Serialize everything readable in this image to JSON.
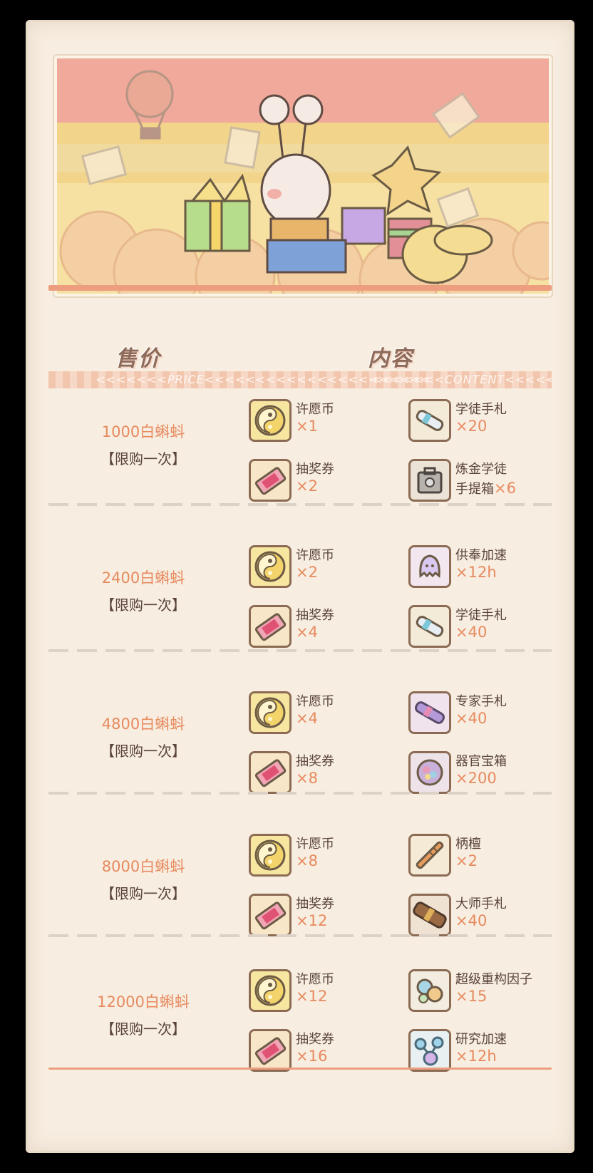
{
  "header": {
    "price_label": "售价",
    "content_label": "内容",
    "price_en": "PRICE",
    "content_en": "CONTENT"
  },
  "colors": {
    "accent": "#e78a5f",
    "text": "#5a443c",
    "rule": "#ec9e7f",
    "paper": "#f7ede0"
  },
  "tiers": [
    {
      "price": "1000白蝌蚪",
      "limit": "【限购一次】",
      "items": [
        {
          "name": "许愿币",
          "qty": "×1",
          "icon": "wish-coin-icon"
        },
        {
          "name": "学徒手札",
          "qty": "×20",
          "icon": "apprentice-scroll-icon"
        },
        {
          "name": "抽奖券",
          "qty": "×2",
          "icon": "lottery-ticket-icon"
        },
        {
          "name": "炼金学徒",
          "name2": "手提箱",
          "qty": "×6",
          "icon": "alchemy-suitcase-icon"
        }
      ]
    },
    {
      "price": "2400白蝌蚪",
      "limit": "【限购一次】",
      "items": [
        {
          "name": "许愿币",
          "qty": "×2",
          "icon": "wish-coin-icon"
        },
        {
          "name": "供奉加速",
          "qty": "×12h",
          "icon": "offering-boost-icon"
        },
        {
          "name": "抽奖券",
          "qty": "×4",
          "icon": "lottery-ticket-icon"
        },
        {
          "name": "学徒手札",
          "qty": "×40",
          "icon": "apprentice-scroll-icon"
        }
      ]
    },
    {
      "price": "4800白蝌蚪",
      "limit": "【限购一次】",
      "items": [
        {
          "name": "许愿币",
          "qty": "×4",
          "icon": "wish-coin-icon"
        },
        {
          "name": "专家手札",
          "qty": "×40",
          "icon": "expert-scroll-icon"
        },
        {
          "name": "抽奖券",
          "qty": "×8",
          "icon": "lottery-ticket-icon"
        },
        {
          "name": "器官宝箱",
          "qty": "×200",
          "icon": "organ-chest-icon"
        }
      ]
    },
    {
      "price": "8000白蝌蚪",
      "limit": "【限购一次】",
      "items": [
        {
          "name": "许愿币",
          "qty": "×8",
          "icon": "wish-coin-icon"
        },
        {
          "name": "柄檀",
          "qty": "×2",
          "icon": "sandalwood-stick-icon"
        },
        {
          "name": "抽奖券",
          "qty": "×12",
          "icon": "lottery-ticket-icon"
        },
        {
          "name": "大师手札",
          "qty": "×40",
          "icon": "master-scroll-icon"
        }
      ]
    },
    {
      "price": "12000白蝌蚪",
      "limit": "【限购一次】",
      "items": [
        {
          "name": "许愿币",
          "qty": "×12",
          "icon": "wish-coin-icon"
        },
        {
          "name": "超级重构因子",
          "qty": "×15",
          "icon": "super-factor-icon"
        },
        {
          "name": "抽奖券",
          "qty": "×16",
          "icon": "lottery-ticket-icon"
        },
        {
          "name": "研究加速",
          "qty": "×12h",
          "icon": "research-boost-icon"
        }
      ]
    }
  ]
}
